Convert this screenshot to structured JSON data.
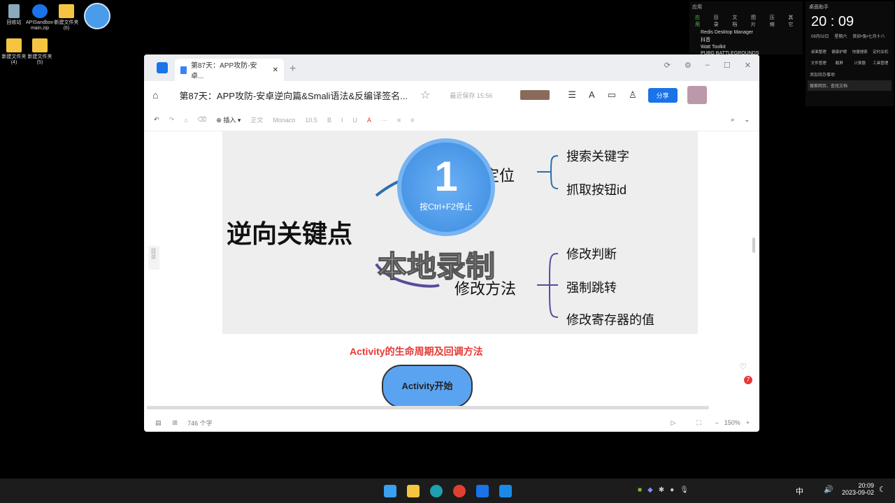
{
  "desktop": {
    "icons": [
      {
        "label": "回收站"
      },
      {
        "label": "APISandbox-main.zip"
      },
      {
        "label": "新建文件夹 (6)"
      },
      {
        "label": "新建文件夹 (4)"
      },
      {
        "label": "新建文件夹 (5)"
      }
    ]
  },
  "apps_widget": {
    "title": "应用",
    "tabs": [
      "应用",
      "目录",
      "文档",
      "图片",
      "压缩",
      "其它"
    ],
    "items": [
      "Redis Desktop Manager",
      "抖音",
      "Watt Toolkit",
      "PUBG BATTLEGROUNDS"
    ]
  },
  "clock_widget": {
    "title": "桌面助手",
    "time": "20 : 09",
    "date": "09月02日",
    "weekday": "星期六",
    "lunar": "癸卯•兔•七月十八",
    "tools": [
      "桌面整理",
      "健康护眼",
      "快捷搜索",
      "定时关机",
      "文件管理",
      "截屏",
      "计算器",
      "工具管理"
    ],
    "todo": "添加待办事项",
    "search_placeholder": "搜索网页、查找文档"
  },
  "browser": {
    "tab_title": "第87天：APP攻防-安卓...",
    "doc_title": "第87天：APP攻防-安卓逆向篇&Smali语法&反编译签名...",
    "saved": "最近保存 15:56",
    "share": "分享"
  },
  "toolbar": {
    "insert": "插入",
    "style": "正文",
    "font": "Monaco",
    "size": "10.5"
  },
  "mindmap": {
    "root": "逆向关键点",
    "branches": [
      {
        "label": "快速定位",
        "children": [
          "搜索关键字",
          "抓取按钮id"
        ]
      },
      {
        "label": "修改方法",
        "children": [
          "修改判断",
          "强制跳转",
          "修改寄存器的值"
        ]
      }
    ]
  },
  "recorder": {
    "count": "1",
    "hint": "按Ctrl+F2停止",
    "watermark": "本地录制"
  },
  "doc": {
    "heading": "Activity的生命周期及回调方法",
    "start_node": "Activity开始",
    "toc": "目录",
    "badge": "7"
  },
  "status": {
    "words": "746 个字",
    "zoom": "150%"
  },
  "taskbar": {
    "ime": "中",
    "time": "20:09",
    "date": "2023-09-02"
  }
}
